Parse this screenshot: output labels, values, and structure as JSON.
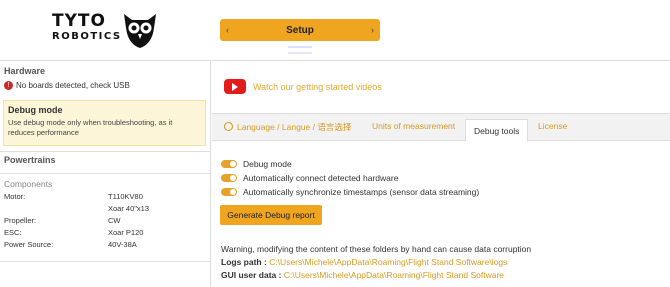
{
  "header": {
    "logo_line1": "TYTO",
    "logo_line2": "ROBOTICS",
    "setup_label": "Setup",
    "prev_arrow": "‹",
    "next_arrow": "›"
  },
  "hardware": {
    "title": "Hardware",
    "status": "No boards detected, check USB"
  },
  "debug_mode": {
    "title": "Debug mode",
    "description": "Use debug mode only when troubleshooting, as it reduces performance"
  },
  "powertrains": {
    "title": "Powertrains",
    "components_label": "Components",
    "rows": [
      {
        "label": "Motor:",
        "value": "T110KV80"
      },
      {
        "label": "",
        "value": "Xoar 40\"x13"
      },
      {
        "label": "Propeller:",
        "value": "CW"
      },
      {
        "label": "ESC:",
        "value": "Xoar P120"
      },
      {
        "label": "Power Source:",
        "value": "40V-38A"
      }
    ]
  },
  "videos": {
    "link_text": "Watch our getting started videos"
  },
  "tabs": [
    {
      "label": "Language / Langue / 语言选择"
    },
    {
      "label": "Units of measurement"
    },
    {
      "label": "Debug tools"
    },
    {
      "label": "License"
    }
  ],
  "debug_tools": {
    "toggles": [
      {
        "label": "Debug mode",
        "on": true
      },
      {
        "label": "Automatically connect detected hardware",
        "on": true
      },
      {
        "label": "Automatically synchronize timestamps (sensor data streaming)",
        "on": true
      }
    ],
    "generate_button": "Generate Debug report",
    "warning": "Warning, modifying the content of these folders by hand can cause data corruption",
    "logs_label": "Logs path :",
    "logs_path": "C:\\Users\\Michele\\AppData\\Roaming\\Flight Stand Software\\logs",
    "gui_label": "GUI user data :",
    "gui_path": "C:\\Users\\Michele\\AppData\\Roaming\\Flight Stand Software"
  },
  "colors": {
    "accent": "#f0a520",
    "link": "#d69a22",
    "error": "#c82a2a",
    "youtube": "#e21b1b"
  }
}
